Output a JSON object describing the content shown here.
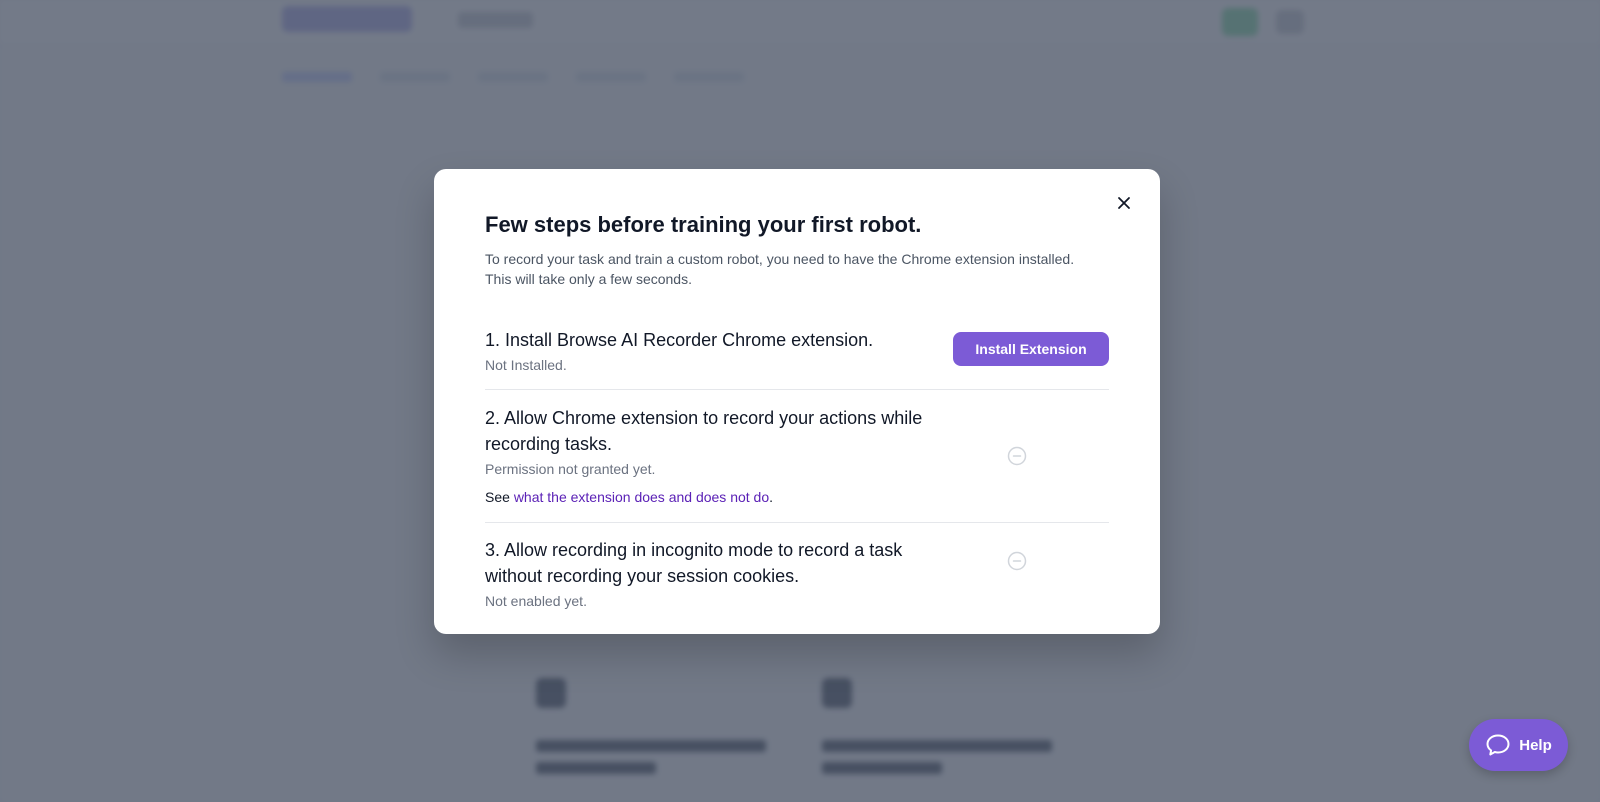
{
  "modal": {
    "title": "Few steps before training your first robot.",
    "description_line1": "To record your task and train a custom robot, you need to have the Chrome extension installed.",
    "description_line2": "This will take only a few seconds.",
    "close_icon": "close-icon"
  },
  "steps": [
    {
      "title": "1. Install Browse AI Recorder Chrome extension.",
      "status": "Not Installed.",
      "action_label": "Install Extension"
    },
    {
      "title_line1": "2. Allow Chrome extension to record your actions while",
      "title_line2": "recording tasks.",
      "status": "Permission not granted yet.",
      "note_prefix": "See ",
      "note_link": "what the extension does and does not do",
      "note_suffix": ".",
      "icon": "pending-minus-circle-icon"
    },
    {
      "title_line1": "3. Allow recording in incognito mode to record a task",
      "title_line2": "without recording your session cookies.",
      "status": "Not enabled yet.",
      "icon": "pending-minus-circle-icon"
    }
  ],
  "help": {
    "label": "Help",
    "icon": "chat-bubble-icon"
  },
  "colors": {
    "accent": "#7c5bd6",
    "link": "#5b21b6",
    "overlay": "rgba(75,85,103,0.78)"
  }
}
